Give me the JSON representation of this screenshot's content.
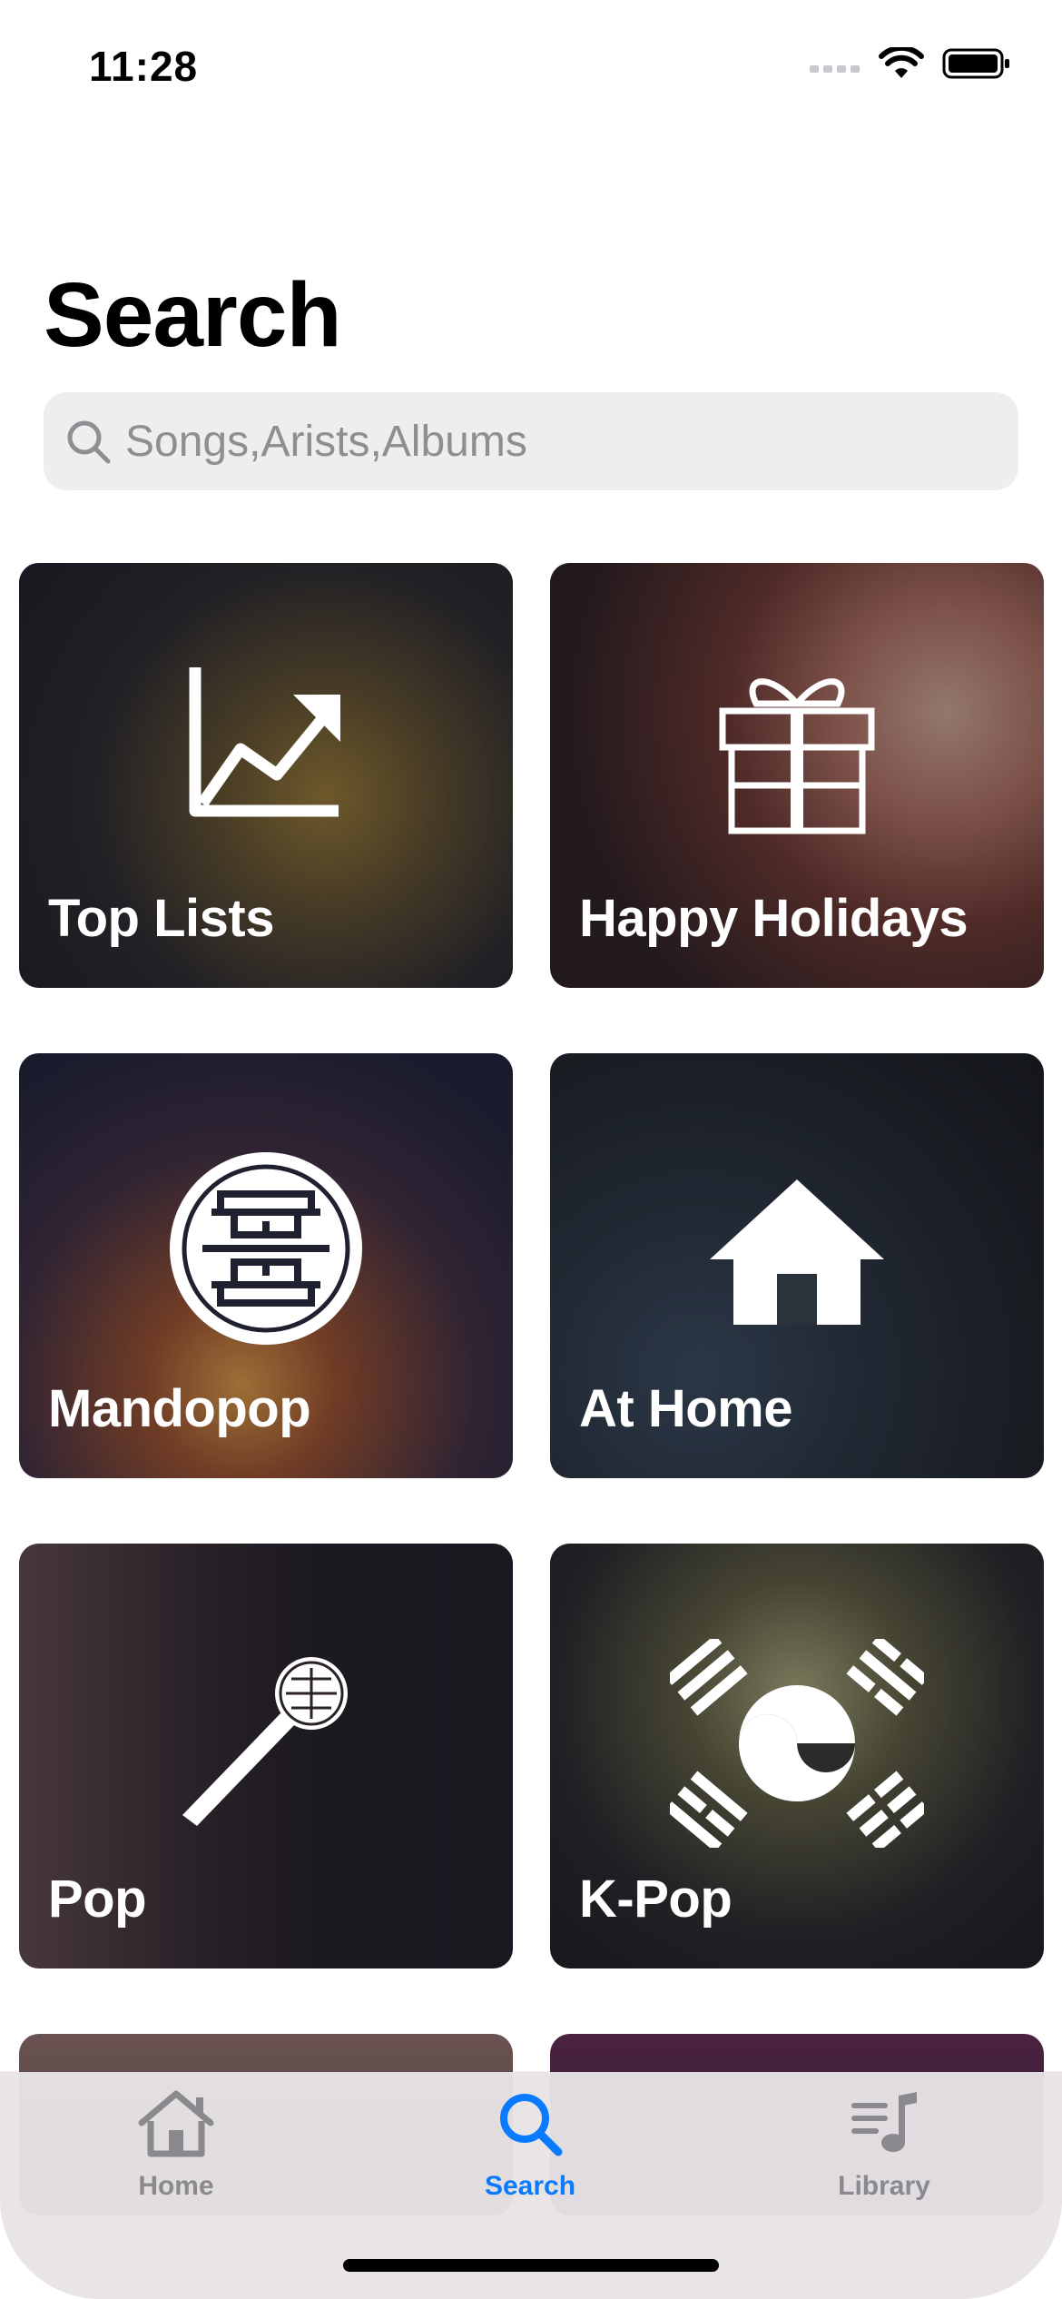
{
  "status": {
    "time": "11:28"
  },
  "page": {
    "title": "Search"
  },
  "search": {
    "placeholder": "Songs,Arists,Albums"
  },
  "categories": [
    {
      "label": "Top Lists",
      "icon": "chart-trending-up-icon"
    },
    {
      "label": "Happy Holidays",
      "icon": "gift-icon"
    },
    {
      "label": "Mandopop",
      "icon": "chinese-knot-emblem-icon"
    },
    {
      "label": "At Home",
      "icon": "house-icon"
    },
    {
      "label": "Pop",
      "icon": "microphone-icon"
    },
    {
      "label": "K-Pop",
      "icon": "taegeuk-flag-icon"
    }
  ],
  "tabs": [
    {
      "label": "Home",
      "icon": "home-icon",
      "active": false
    },
    {
      "label": "Search",
      "icon": "search-icon",
      "active": true
    },
    {
      "label": "Library",
      "icon": "music-library-icon",
      "active": false
    }
  ],
  "colors": {
    "accent": "#0a7aff",
    "inactive": "#8a8a8e",
    "search_bg": "#eeeeef"
  }
}
